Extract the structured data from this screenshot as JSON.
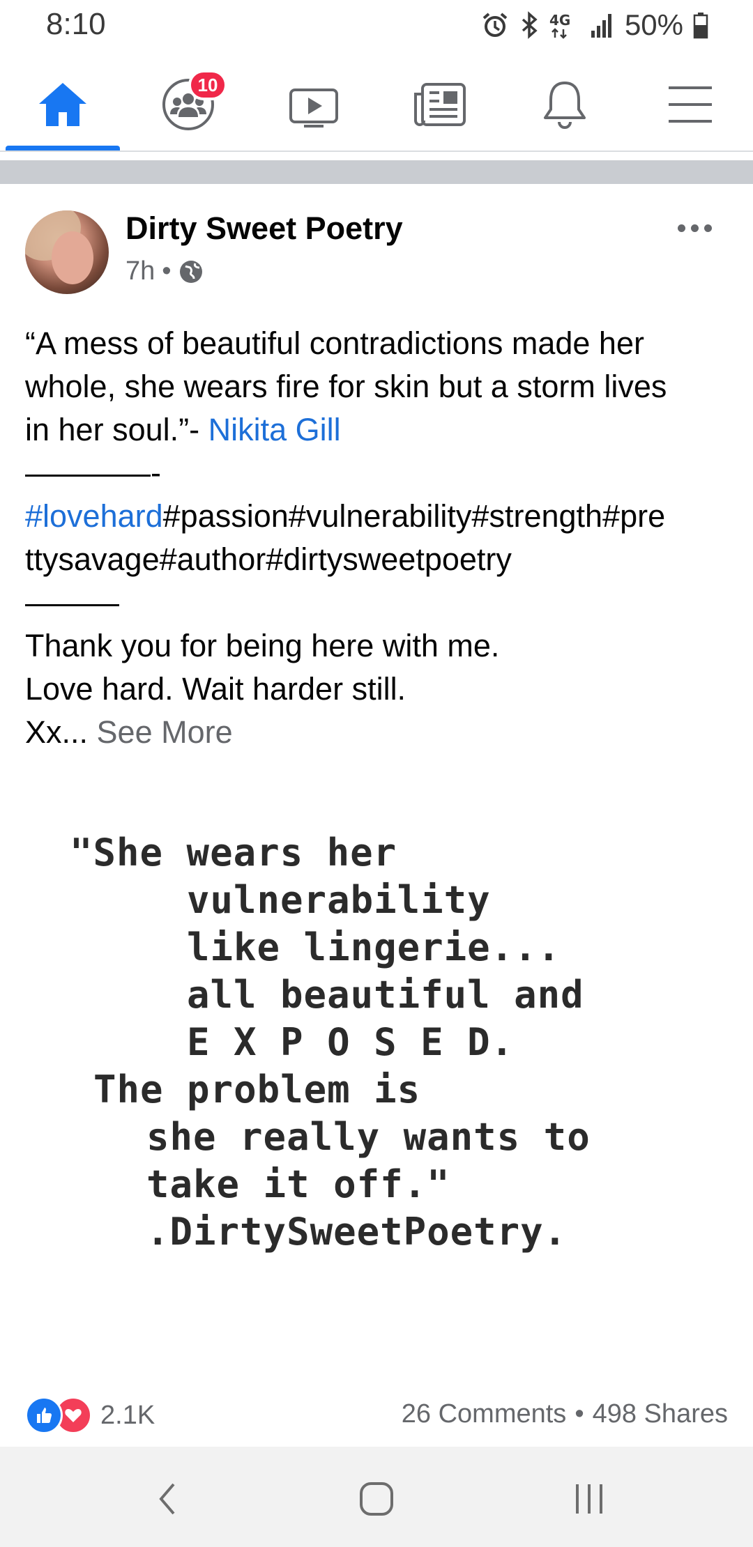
{
  "status_bar": {
    "time": "8:10",
    "network": "4G",
    "battery": "50%",
    "icons": [
      "alarm-icon",
      "bluetooth-icon",
      "4g-lte-icon",
      "signal-icon",
      "battery-icon"
    ]
  },
  "nav": {
    "items": [
      {
        "name": "home",
        "icon": "home-icon",
        "active": true
      },
      {
        "name": "groups",
        "icon": "groups-icon"
      },
      {
        "name": "watch",
        "icon": "watch-icon",
        "badge": "10"
      },
      {
        "name": "news",
        "icon": "news-icon"
      },
      {
        "name": "notifications",
        "icon": "bell-icon"
      },
      {
        "name": "menu",
        "icon": "hamburger-menu-icon"
      }
    ],
    "accent": "#1877f2"
  },
  "post": {
    "author": "Dirty Sweet Poetry",
    "time": "7h",
    "privacy_icon": "globe-icon",
    "text": {
      "line1": "“A mess of beautiful contradictions made her",
      "line2": "whole, she wears fire for skin but a storm lives",
      "line3_prefix": "in her soul.”- ",
      "line3_link": "Nikita Gill",
      "line4": "————-",
      "line5_link": "#lovehard",
      "line5_rest": "#passion#vulnerability#strength#pre",
      "line6": "ttysavage#author#dirtysweetpoetry",
      "line7": "———",
      "line8": "Thank you for being here with me.",
      "line9": "Love hard.  Wait harder still.",
      "line10_prefix": "Xx... ",
      "see_more": "See More"
    },
    "image_text": {
      "l1": "\"She wears her",
      "l2": "vulnerability",
      "l3": "like lingerie...",
      "l4": "all beautiful and",
      "l5": "E X P O S E D.",
      "l6": "The problem is",
      "l7": "she really wants to",
      "l8": "take it off.\"",
      "l9": ".DirtySweetPoetry."
    },
    "reactions": {
      "count": "2.1K",
      "types": [
        "like-icon",
        "love-icon"
      ]
    },
    "comments": "26 Comments",
    "separator": "•",
    "shares": "498 Shares"
  },
  "system_nav": {
    "buttons": [
      "back-icon",
      "home-circle-icon",
      "recents-icon"
    ]
  }
}
